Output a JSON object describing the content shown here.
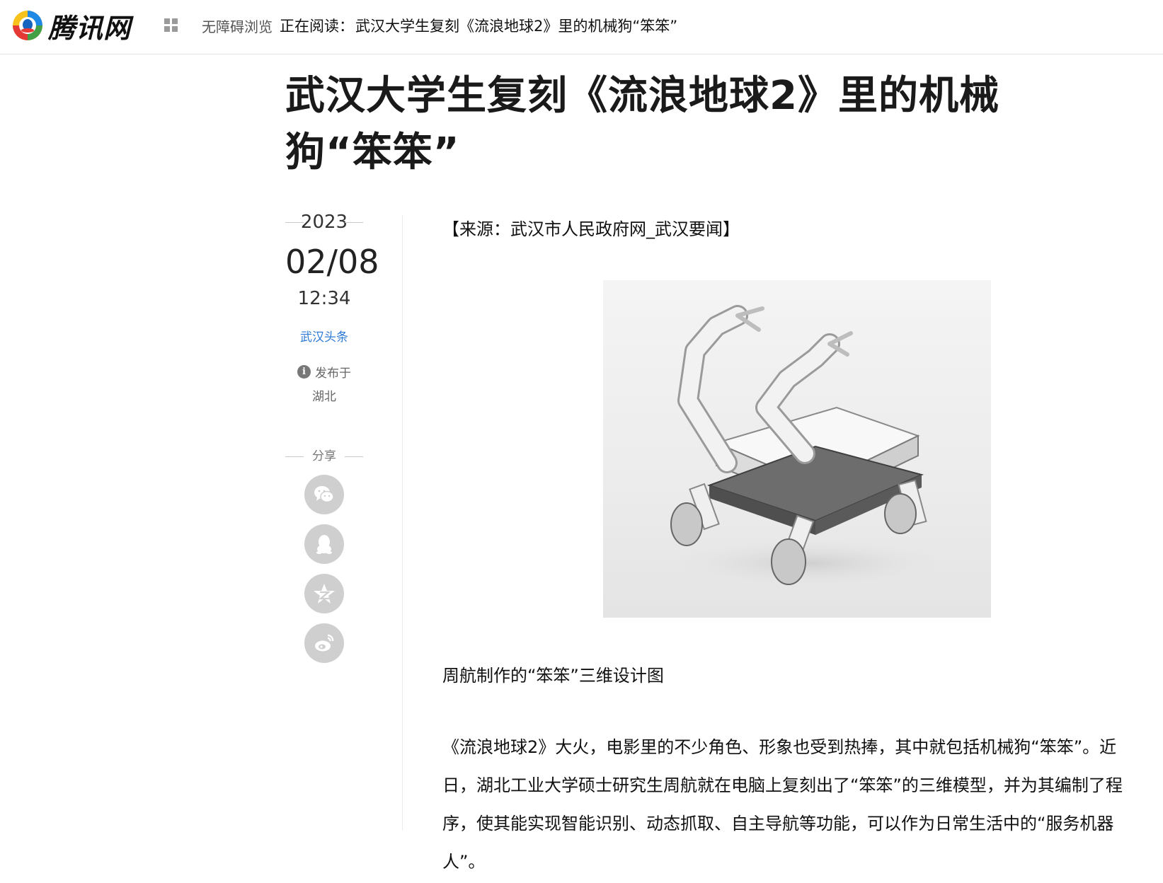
{
  "header": {
    "logo_text": "腾讯网",
    "accessibility_label": "无障碍浏览",
    "reading_prefix": "正在阅读：",
    "reading_title": "武汉大学生复刻《流浪地球2》里的机械狗“笨笨”"
  },
  "article": {
    "title": "武汉大学生复刻《流浪地球2》里的机械狗“笨笨”",
    "source": "【来源：武汉市人民政府网_武汉要闻】",
    "caption": "周航制作的“笨笨”三维设计图",
    "paragraph": "《流浪地球2》大火，电影里的不少角色、形象也受到热捧，其中就包括机械狗“笨笨”。近日，湖北工业大学硕士研究生周航就在电脑上复刻出了“笨笨”的三维模型，并为其编制了程序，使其能实现智能识别、动态抓取、自主导航等功能，可以作为日常生活中的“服务机器人”。"
  },
  "meta": {
    "year": "2023",
    "date": "02/08",
    "time": "12:34",
    "channel": "武汉头条",
    "published_label": "发布于",
    "location": "湖北",
    "share_label": "分享"
  },
  "share_buttons": [
    "wechat-icon",
    "qq-icon",
    "qzone-icon",
    "weibo-icon"
  ],
  "colors": {
    "link": "#2d7ad6",
    "share_bg": "#cfcfcf"
  }
}
